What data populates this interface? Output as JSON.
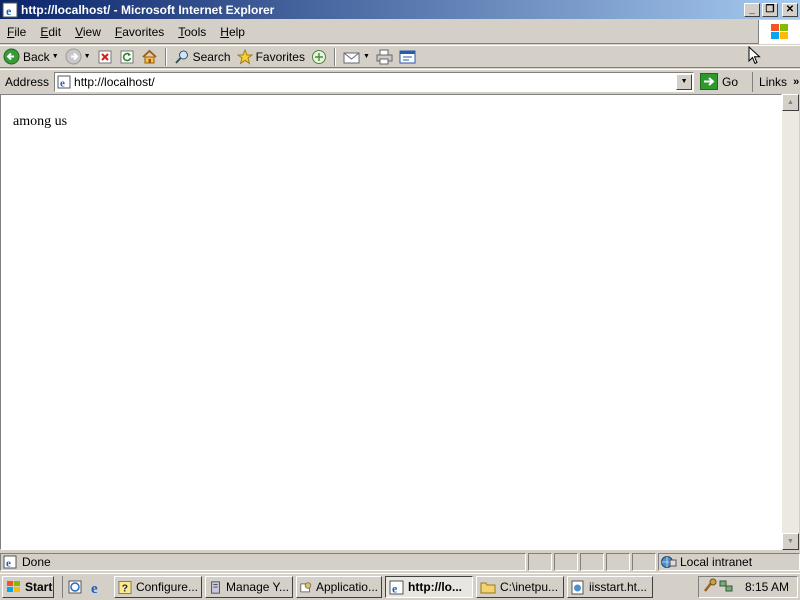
{
  "window": {
    "title": "http://localhost/ - Microsoft Internet Explorer",
    "controls": {
      "minimize": "_",
      "maximize": "❐",
      "close": "✕"
    }
  },
  "menu": {
    "items": [
      {
        "label": "File",
        "acc": "F",
        "rest": "ile"
      },
      {
        "label": "Edit",
        "acc": "E",
        "rest": "dit"
      },
      {
        "label": "View",
        "acc": "V",
        "rest": "iew"
      },
      {
        "label": "Favorites",
        "acc": "F",
        "rest": "avorites"
      },
      {
        "label": "Tools",
        "acc": "T",
        "rest": "ools"
      },
      {
        "label": "Help",
        "acc": "H",
        "rest": "elp"
      }
    ]
  },
  "toolbar": {
    "back_label": "Back",
    "search_label": "Search",
    "favorites_label": "Favorites"
  },
  "address": {
    "label": "Address",
    "url": "http://localhost/",
    "go_label": "Go",
    "links_label": "Links"
  },
  "page": {
    "body_text": "among us"
  },
  "status": {
    "text": "Done",
    "zone": "Local intranet"
  },
  "taskbar": {
    "start_label": "Start",
    "tasks": [
      {
        "label": "Configure...",
        "icon": "help-icon",
        "active": false
      },
      {
        "label": "Manage Y...",
        "icon": "server-icon",
        "active": false
      },
      {
        "label": "Applicatio...",
        "icon": "app-icon",
        "active": false
      },
      {
        "label": "http://lo...",
        "icon": "ie-icon",
        "active": true
      },
      {
        "label": "C:\\inetpu...",
        "icon": "folder-icon",
        "active": false
      },
      {
        "label": "iisstart.ht...",
        "icon": "document-icon",
        "active": false
      }
    ],
    "clock": "8:15 AM"
  },
  "colors": {
    "titlebar_start": "#0a246a",
    "titlebar_end": "#a6caf0",
    "chrome": "#d4d0c8"
  }
}
